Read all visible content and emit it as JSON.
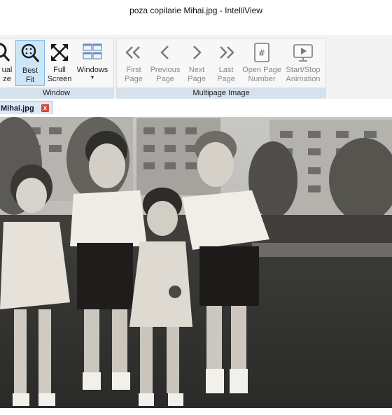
{
  "window": {
    "title": "poza copilarie Mihai.jpg - IntelliView"
  },
  "ribbon": {
    "window_group": {
      "label": "Window",
      "buttons": [
        {
          "line1": "ual",
          "line2": "ze",
          "icon": "magnifier-icon"
        },
        {
          "line1": "Best",
          "line2": "Fit",
          "icon": "best-fit-icon",
          "selected": true
        },
        {
          "line1": "Full",
          "line2": "Screen",
          "icon": "full-screen-icon"
        },
        {
          "line1": "Windows",
          "line2": "▾",
          "icon": "windows-icon"
        }
      ]
    },
    "multipage_group": {
      "label": "Multipage Image",
      "buttons": [
        {
          "line1": "First",
          "line2": "Page",
          "icon": "first-page-icon"
        },
        {
          "line1": "Previous",
          "line2": "Page",
          "icon": "previous-page-icon"
        },
        {
          "line1": "Next",
          "line2": "Page",
          "icon": "next-page-icon"
        },
        {
          "line1": "Last",
          "line2": "Page",
          "icon": "last-page-icon"
        },
        {
          "line1": "Open Page",
          "line2": "Number",
          "icon": "open-page-number-icon"
        },
        {
          "line1": "Start/Stop",
          "line2": "Animation",
          "icon": "start-stop-animation-icon"
        }
      ]
    }
  },
  "tabs": [
    {
      "label": "Mihai.jpg",
      "close": "x"
    }
  ],
  "colors": {
    "selected_bg": "#cde6f7",
    "group_label_bg": "#d5e1ec",
    "close_red": "#d9473d"
  }
}
